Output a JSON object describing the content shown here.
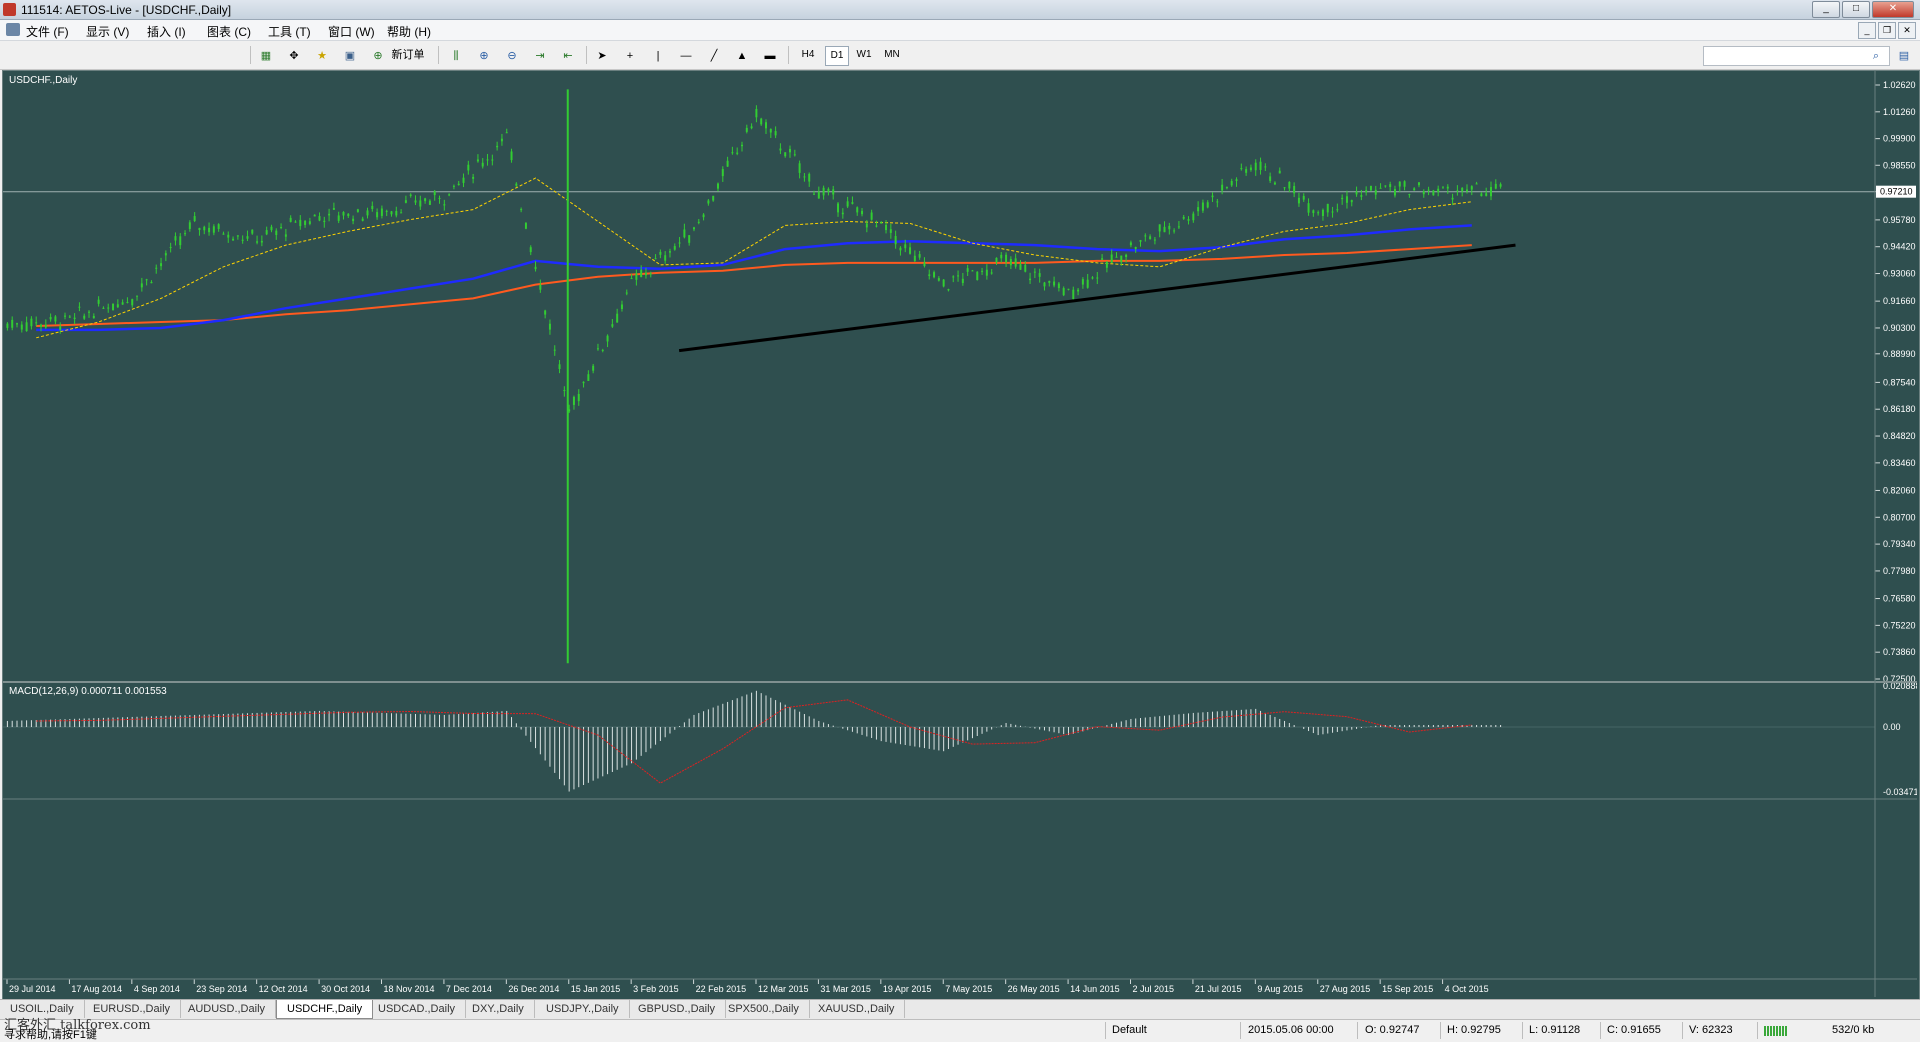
{
  "window": {
    "title": "111514: AETOS-Live - [USDCHF.,Daily]",
    "min": "_",
    "max": "□",
    "close": "✕"
  },
  "menu": [
    "文件 (F)",
    "显示 (V)",
    "插入 (I)",
    "图表 (C)",
    "工具 (T)",
    "窗口 (W)",
    "帮助 (H)"
  ],
  "toolbar": {
    "new_order": "新订单",
    "timeframes": [
      "H4",
      "D1",
      "W1",
      "MN"
    ],
    "active_timeframe": "D1"
  },
  "chart": {
    "label": "USDCHF.,Daily",
    "bg": "#2f4f4f",
    "candle_color": "#32cd32",
    "current_price": "0.97210",
    "price_ticks": [
      "1.02620",
      "1.01260",
      "0.99900",
      "0.98550",
      "0.97210",
      "0.95780",
      "0.94420",
      "0.93060",
      "0.91660",
      "0.90300",
      "0.88990",
      "0.87540",
      "0.86180",
      "0.84820",
      "0.83460",
      "0.82060",
      "0.80700",
      "0.79340",
      "0.77980",
      "0.76580",
      "0.75220",
      "0.73860",
      "0.72500"
    ],
    "date_ticks": [
      "29 Jul 2014",
      "17 Aug 2014",
      "4 Sep 2014",
      "23 Sep 2014",
      "12 Oct 2014",
      "30 Oct 2014",
      "18 Nov 2014",
      "7 Dec 2014",
      "26 Dec 2014",
      "15 Jan 2015",
      "3 Feb 2015",
      "22 Feb 2015",
      "12 Mar 2015",
      "31 Mar 2015",
      "19 Apr 2015",
      "7 May 2015",
      "26 May 2015",
      "14 Jun 2015",
      "2 Jul 2015",
      "21 Jul 2015",
      "9 Aug 2015",
      "27 Aug 2015",
      "15 Sep 2015",
      "4 Oct 2015"
    ],
    "macd_label": "MACD(12,26,9) 0.000711 0.001553",
    "macd_ticks": [
      "0.020888",
      "0.00",
      "-0.034712"
    ]
  },
  "chart_data": {
    "type": "candlestick",
    "symbol": "USDCHF.",
    "timeframe": "Daily",
    "price_range": [
      0.725,
      1.0262
    ],
    "close_path": [
      {
        "date": "29 Jul 2014",
        "close": 0.905
      },
      {
        "date": "17 Aug 2014",
        "close": 0.907
      },
      {
        "date": "4 Sep 2014",
        "close": 0.919
      },
      {
        "date": "23 Sep 2014",
        "close": 0.956
      },
      {
        "date": "12 Oct 2014",
        "close": 0.948
      },
      {
        "date": "30 Oct 2014",
        "close": 0.96
      },
      {
        "date": "18 Nov 2014",
        "close": 0.962
      },
      {
        "date": "7 Dec 2014",
        "close": 0.97
      },
      {
        "date": "26 Dec 2014",
        "close": 0.999
      },
      {
        "date": "15 Jan 2015",
        "close": 0.86
      },
      {
        "date": "3 Feb 2015",
        "close": 0.925
      },
      {
        "date": "22 Feb 2015",
        "close": 0.953
      },
      {
        "date": "12 Mar 2015",
        "close": 1.011
      },
      {
        "date": "31 Mar 2015",
        "close": 0.972
      },
      {
        "date": "19 Apr 2015",
        "close": 0.955
      },
      {
        "date": "7 May 2015",
        "close": 0.925
      },
      {
        "date": "26 May 2015",
        "close": 0.937
      },
      {
        "date": "14 Jun 2015",
        "close": 0.921
      },
      {
        "date": "2 Jul 2015",
        "close": 0.944
      },
      {
        "date": "21 Jul 2015",
        "close": 0.961
      },
      {
        "date": "9 Aug 2015",
        "close": 0.987
      },
      {
        "date": "27 Aug 2015",
        "close": 0.963
      },
      {
        "date": "15 Sep 2015",
        "close": 0.974
      },
      {
        "date": "4 Oct 2015",
        "close": 0.9721
      }
    ],
    "spike": {
      "date": "15 Jan 2015",
      "high": 1.024,
      "low": 0.733
    },
    "ma_fast": [
      0.898,
      0.906,
      0.918,
      0.934,
      0.945,
      0.952,
      0.958,
      0.963,
      0.979,
      0.957,
      0.935,
      0.936,
      0.955,
      0.957,
      0.956,
      0.946,
      0.94,
      0.936,
      0.934,
      0.944,
      0.952,
      0.956,
      0.963,
      0.967
    ],
    "ma_blue": [
      0.902,
      0.902,
      0.903,
      0.907,
      0.913,
      0.918,
      0.923,
      0.928,
      0.937,
      0.934,
      0.933,
      0.935,
      0.943,
      0.946,
      0.947,
      0.946,
      0.945,
      0.943,
      0.942,
      0.944,
      0.948,
      0.95,
      0.953,
      0.955
    ],
    "ma_orange": [
      0.904,
      0.905,
      0.906,
      0.907,
      0.91,
      0.912,
      0.915,
      0.918,
      0.925,
      0.929,
      0.931,
      0.932,
      0.935,
      0.936,
      0.936,
      0.936,
      0.936,
      0.937,
      0.937,
      0.938,
      0.94,
      0.941,
      0.943,
      0.945
    ],
    "trendline": [
      {
        "date": "19 Feb 2015",
        "price": 0.8915
      },
      {
        "date": "22 Oct 2015",
        "price": 0.945
      }
    ],
    "macd_histogram": [
      0.003,
      0.004,
      0.005,
      0.006,
      0.007,
      0.008,
      0.007,
      0.006,
      0.008,
      -0.032,
      -0.018,
      0.006,
      0.018,
      0.003,
      -0.007,
      -0.012,
      0.002,
      -0.004,
      0.004,
      0.007,
      0.009,
      -0.004,
      0.001,
      0.001
    ]
  },
  "tabs": [
    "USOIL.,Daily",
    "EURUSD.,Daily",
    "AUDUSD.,Daily",
    "USDCHF.,Daily",
    "USDCAD.,Daily",
    "DXY.,Daily",
    "USDJPY.,Daily",
    "GBPUSD.,Daily",
    "SPX500.,Daily",
    "XAUUSD.,Daily"
  ],
  "active_tab": "USDCHF.,Daily",
  "status": {
    "help": "寻求帮助,请按F1键",
    "profile": "Default",
    "datetime": "2015.05.06 00:00",
    "open": "O: 0.92747",
    "high": "H: 0.92795",
    "low": "L: 0.91128",
    "close": "C: 0.91655",
    "volume": "V: 62323",
    "traffic": "532/0 kb"
  },
  "watermark": "汇客外汇 talkforex.com"
}
